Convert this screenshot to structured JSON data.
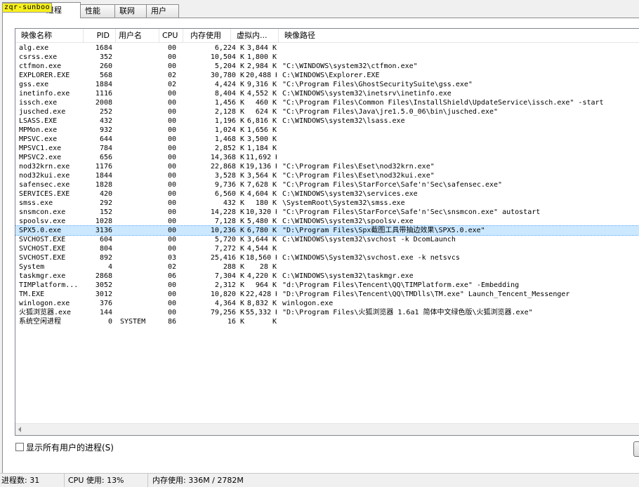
{
  "watermark": "zqr-sunboo",
  "tabs": [
    {
      "label": "进程"
    },
    {
      "label": "性能"
    },
    {
      "label": "联网"
    },
    {
      "label": "用户"
    }
  ],
  "columns": [
    "映像名称",
    "PID",
    "用户名",
    "CPU",
    "内存使用",
    "虚拟内...",
    "映像路径"
  ],
  "processes": [
    {
      "name": "alg.exe",
      "pid": "1684",
      "user": "",
      "cpu": "00",
      "mem": "6,224 K",
      "vm": "3,844 K",
      "path": ""
    },
    {
      "name": "csrss.exe",
      "pid": "352",
      "user": "",
      "cpu": "00",
      "mem": "10,504 K",
      "vm": "1,800 K",
      "path": ""
    },
    {
      "name": "ctfmon.exe",
      "pid": "260",
      "user": "",
      "cpu": "00",
      "mem": "5,204 K",
      "vm": "2,984 K",
      "path": "\"C:\\WINDOWS\\system32\\ctfmon.exe\""
    },
    {
      "name": "EXPLORER.EXE",
      "pid": "568",
      "user": "",
      "cpu": "02",
      "mem": "30,780 K",
      "vm": "20,488 K",
      "path": "C:\\WINDOWS\\Explorer.EXE"
    },
    {
      "name": "gss.exe",
      "pid": "1884",
      "user": "",
      "cpu": "02",
      "mem": "4,424 K",
      "vm": "9,316 K",
      "path": "\"C:\\Program Files\\GhostSecuritySuite\\gss.exe\""
    },
    {
      "name": "inetinfo.exe",
      "pid": "1116",
      "user": "",
      "cpu": "00",
      "mem": "8,404 K",
      "vm": "4,552 K",
      "path": "C:\\WINDOWS\\system32\\inetsrv\\inetinfo.exe"
    },
    {
      "name": "issch.exe",
      "pid": "2008",
      "user": "",
      "cpu": "00",
      "mem": "1,456 K",
      "vm": "460 K",
      "path": "\"C:\\Program Files\\Common Files\\InstallShield\\UpdateService\\issch.exe\" -start"
    },
    {
      "name": "jusched.exe",
      "pid": "252",
      "user": "",
      "cpu": "00",
      "mem": "2,128 K",
      "vm": "624 K",
      "path": "\"C:\\Program Files\\Java\\jre1.5.0_06\\bin\\jusched.exe\""
    },
    {
      "name": "LSASS.EXE",
      "pid": "432",
      "user": "",
      "cpu": "00",
      "mem": "1,196 K",
      "vm": "6,816 K",
      "path": "C:\\WINDOWS\\system32\\lsass.exe"
    },
    {
      "name": "MPMon.exe",
      "pid": "932",
      "user": "",
      "cpu": "00",
      "mem": "1,024 K",
      "vm": "1,656 K",
      "path": ""
    },
    {
      "name": "MPSVC.exe",
      "pid": "644",
      "user": "",
      "cpu": "00",
      "mem": "1,468 K",
      "vm": "3,500 K",
      "path": ""
    },
    {
      "name": "MPSVC1.exe",
      "pid": "784",
      "user": "",
      "cpu": "00",
      "mem": "2,852 K",
      "vm": "1,184 K",
      "path": ""
    },
    {
      "name": "MPSVC2.exe",
      "pid": "656",
      "user": "",
      "cpu": "00",
      "mem": "14,368 K",
      "vm": "11,692 K",
      "path": ""
    },
    {
      "name": "nod32krn.exe",
      "pid": "1176",
      "user": "",
      "cpu": "00",
      "mem": "22,868 K",
      "vm": "19,136 K",
      "path": "\"C:\\Program Files\\Eset\\nod32krn.exe\""
    },
    {
      "name": "nod32kui.exe",
      "pid": "1844",
      "user": "",
      "cpu": "00",
      "mem": "3,528 K",
      "vm": "3,564 K",
      "path": "\"C:\\Program Files\\Eset\\nod32kui.exe\""
    },
    {
      "name": "safensec.exe",
      "pid": "1828",
      "user": "",
      "cpu": "00",
      "mem": "9,736 K",
      "vm": "7,628 K",
      "path": "\"C:\\Program Files\\StarForce\\Safe'n'Sec\\safensec.exe\""
    },
    {
      "name": "SERVICES.EXE",
      "pid": "420",
      "user": "",
      "cpu": "00",
      "mem": "6,560 K",
      "vm": "4,604 K",
      "path": "C:\\WINDOWS\\system32\\services.exe"
    },
    {
      "name": "smss.exe",
      "pid": "292",
      "user": "",
      "cpu": "00",
      "mem": "432 K",
      "vm": "180 K",
      "path": "\\SystemRoot\\System32\\smss.exe"
    },
    {
      "name": "snsmcon.exe",
      "pid": "152",
      "user": "",
      "cpu": "00",
      "mem": "14,228 K",
      "vm": "10,320 K",
      "path": "\"C:\\Program Files\\StarForce\\Safe'n'Sec\\snsmcon.exe\" autostart"
    },
    {
      "name": "spoolsv.exe",
      "pid": "1028",
      "user": "",
      "cpu": "00",
      "mem": "7,128 K",
      "vm": "5,480 K",
      "path": "C:\\WINDOWS\\system32\\spoolsv.exe"
    },
    {
      "name": "SPX5.0.exe",
      "pid": "3136",
      "user": "",
      "cpu": "00",
      "mem": "10,236 K",
      "vm": "6,780 K",
      "path": "\"D:\\Program Files\\Spx截图工具带抽边效果\\SPX5.0.exe\"",
      "selected": true
    },
    {
      "name": "SVCHOST.EXE",
      "pid": "604",
      "user": "",
      "cpu": "00",
      "mem": "5,720 K",
      "vm": "3,644 K",
      "path": "C:\\WINDOWS\\system32\\svchost -k DcomLaunch"
    },
    {
      "name": "SVCHOST.EXE",
      "pid": "804",
      "user": "",
      "cpu": "00",
      "mem": "7,272 K",
      "vm": "4,544 K",
      "path": ""
    },
    {
      "name": "SVCHOST.EXE",
      "pid": "892",
      "user": "",
      "cpu": "03",
      "mem": "25,416 K",
      "vm": "18,560 K",
      "path": "C:\\WINDOWS\\System32\\svchost.exe -k netsvcs"
    },
    {
      "name": "System",
      "pid": "4",
      "user": "",
      "cpu": "02",
      "mem": "288 K",
      "vm": "28 K",
      "path": ""
    },
    {
      "name": "taskmgr.exe",
      "pid": "2868",
      "user": "",
      "cpu": "06",
      "mem": "7,304 K",
      "vm": "4,220 K",
      "path": "C:\\WINDOWS\\system32\\taskmgr.exe"
    },
    {
      "name": "TIMPlatform...",
      "pid": "3052",
      "user": "",
      "cpu": "00",
      "mem": "2,312 K",
      "vm": "964 K",
      "path": "\"d:\\Program Files\\Tencent\\QQ\\TIMPlatform.exe\" -Embedding"
    },
    {
      "name": "TM.EXE",
      "pid": "3012",
      "user": "",
      "cpu": "00",
      "mem": "10,820 K",
      "vm": "22,428 K",
      "path": "\"D:\\Program Files\\Tencent\\QQ\\TMDlls\\TM.exe\" Launch_Tencent_Messenger"
    },
    {
      "name": "winlogon.exe",
      "pid": "376",
      "user": "",
      "cpu": "00",
      "mem": "4,364 K",
      "vm": "8,832 K",
      "path": "winlogon.exe"
    },
    {
      "name": "火狐浏览器.exe",
      "pid": "144",
      "user": "",
      "cpu": "00",
      "mem": "79,256 K",
      "vm": "55,332 K",
      "path": "\"D:\\Program Files\\火狐浏览器 1.6a1 简体中文绿色版\\火狐浏览器.exe\""
    },
    {
      "name": "系统空闲进程",
      "pid": "0",
      "user": "SYSTEM",
      "cpu": "86",
      "mem": "16 K",
      "vm": "K",
      "path": ""
    }
  ],
  "show_all_users_label": "显示所有用户的进程(S)",
  "status": {
    "processes": "进程数: 31",
    "cpu": "CPU 使用: 13%",
    "memory": "内存使用: 336M / 2782M"
  },
  "colors": {
    "selected_row": "#cce8ff",
    "watermark": "#f7f01c"
  }
}
